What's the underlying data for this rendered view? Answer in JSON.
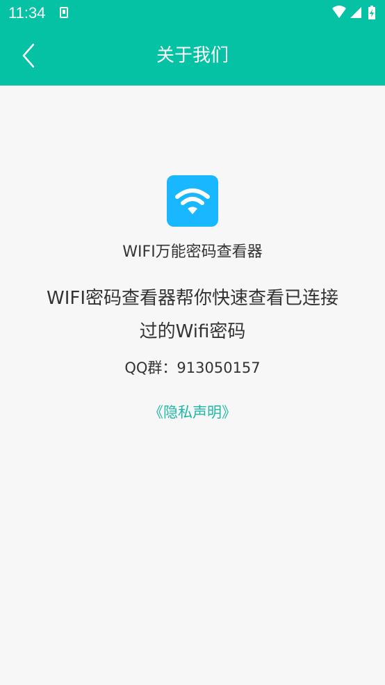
{
  "status_bar": {
    "time": "11:34"
  },
  "header": {
    "title": "关于我们"
  },
  "about": {
    "app_name": "WIFI万能密码查看器",
    "description": "WIFI密码查看器帮你快速查看已连接过的Wifi密码",
    "qq_group": "QQ群：913050157",
    "privacy_link": "《隐私声明》"
  },
  "icons": {
    "back": "chevron-left-icon",
    "logo": "wifi-icon",
    "wifi_status": "wifi-icon",
    "signal": "signal-icon",
    "battery": "battery-icon"
  },
  "colors": {
    "primary": "#05c2a4",
    "logo_bg": "#18b7ff",
    "link": "#1fb8a6",
    "text": "#333333",
    "background": "#f7f7f7"
  }
}
